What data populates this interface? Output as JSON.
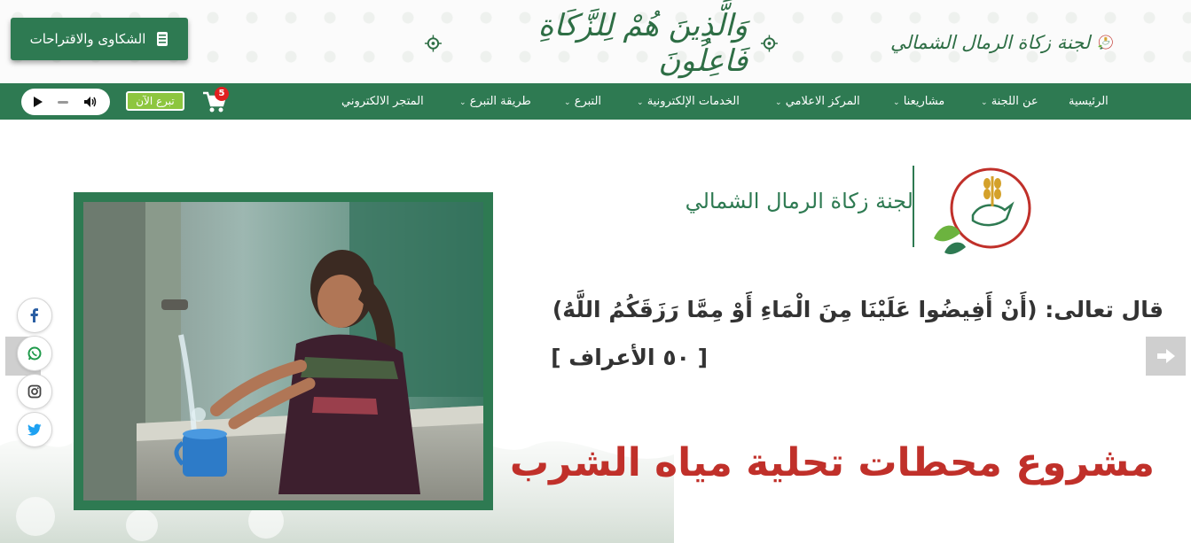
{
  "header": {
    "complaints_label": "الشكاوى والاقتراحات",
    "slogan": "وَالَّذِينَ هُمْ لِلزَّكَاةِ فَاعِلُونَ",
    "brand_name": "لجنة زكاة الرمال الشمالي"
  },
  "nav": {
    "items": [
      {
        "label": "الرئيسية"
      },
      {
        "label": "عن اللجنة"
      },
      {
        "label": "مشاريعنا"
      },
      {
        "label": "المركز الاعلامي"
      },
      {
        "label": "الخدمات الإلكترونية"
      },
      {
        "label": "التبرع"
      },
      {
        "label": "طريقة التبرع"
      },
      {
        "label": "المتجر الالكتروني"
      }
    ],
    "donate_now": "تبرع الآن",
    "cart_count": "5"
  },
  "hero": {
    "committee_name": "لجنة زكاة الرمال الشمالي",
    "verse": "قال تعالى: (أَنْ أَفِيضُوا عَلَيْنَا مِنَ الْمَاءِ أَوْ مِمَّا رَزَقَكُمُ اللَّهُ)",
    "verse_ref": "[ ٥٠ الأعراف ]",
    "project_title": "مشروع محطات تحلية مياه الشرب"
  },
  "social": [
    "facebook-icon",
    "whatsapp-icon",
    "instagram-icon",
    "twitter-icon"
  ],
  "colors": {
    "primary_green": "#2e7a52",
    "accent_red": "#c0302a",
    "donate_green": "#8dc63f",
    "badge_red": "#e02020"
  }
}
